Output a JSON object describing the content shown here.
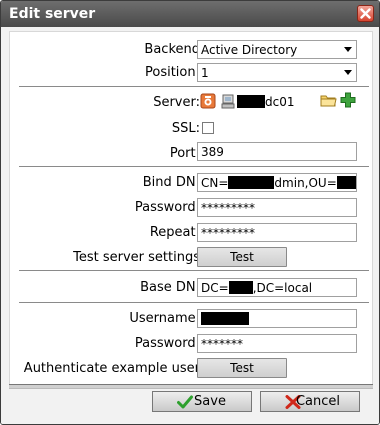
{
  "dialog": {
    "title": "Edit server"
  },
  "form": {
    "backend_label": "Backend",
    "backend_value": "Active Directory",
    "position_label": "Position:",
    "position_value": "1",
    "server_label": "Server:",
    "server_value_suffix": "dc01",
    "ssl_label": "SSL:",
    "ssl_checked": false,
    "port_label": "Port:",
    "port_value": "389",
    "bind_dn_label": "Bind DN:",
    "bind_dn_part1": "CN=",
    "bind_dn_part2": "dmin,OU=",
    "bind_dn_part3": "-",
    "password_label": "Password:",
    "password_value": "*********",
    "repeat_label": "Repeat:",
    "repeat_value": "*********",
    "test_server_label": "Test server settings",
    "test_button": "Test",
    "base_dn_label": "Base DN:",
    "base_dn_part1": "DC=",
    "base_dn_part2": ",DC=local",
    "username_label": "Username:",
    "user_password_label": "Password:",
    "user_password_value": "*******",
    "auth_example_label": "Authenticate example user",
    "auth_test_button": "Test"
  },
  "footer": {
    "save_label": "Save",
    "cancel_label": "Cancel"
  },
  "icons": {
    "close": "close-icon",
    "server_type": "server-icon",
    "computer": "computer-icon",
    "folder": "folder-icon",
    "add": "add-icon",
    "check": "check-icon",
    "cross": "cross-icon"
  },
  "colors": {
    "titlebar": "#5a5a5a",
    "close_button": "#d6442f",
    "save_check": "#2ea02e",
    "cancel_cross": "#d0281a"
  }
}
